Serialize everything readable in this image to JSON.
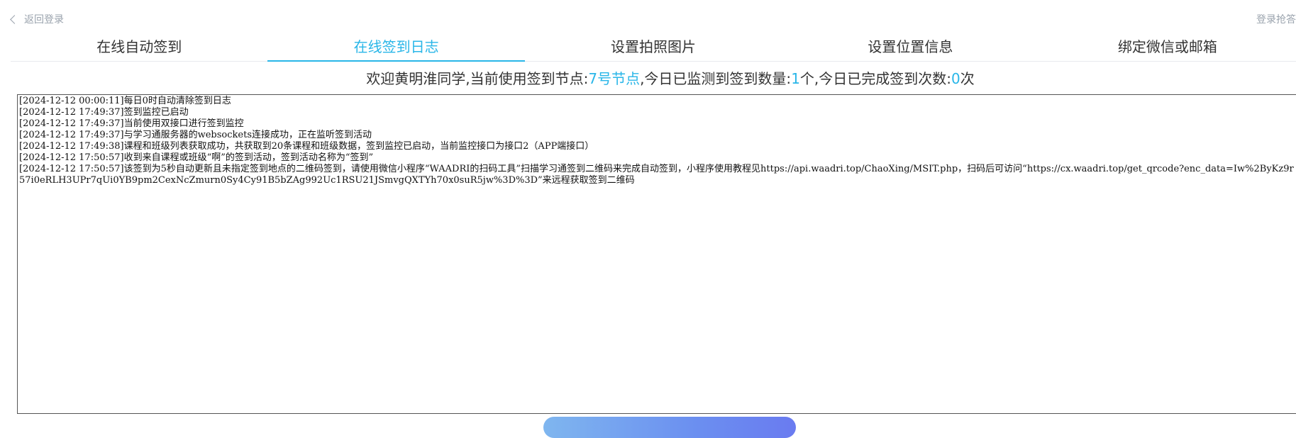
{
  "topbar": {
    "back_label": "返回登录",
    "login_label": "登录抢答"
  },
  "tabs": [
    {
      "label": "在线自动签到",
      "active": false
    },
    {
      "label": "在线签到日志",
      "active": true
    },
    {
      "label": "设置拍照图片",
      "active": false
    },
    {
      "label": "设置位置信息",
      "active": false
    },
    {
      "label": "绑定微信或邮箱",
      "active": false
    }
  ],
  "welcome": {
    "prefix": "欢迎黄明淮同学,当前使用签到节点:",
    "node": "7号节点",
    "mid1": ",今日已监测到签到数量:",
    "detected_count": "1",
    "mid2": "个,今日已完成签到次数:",
    "completed_count": "0",
    "suffix": "次"
  },
  "log": [
    "[2024-12-12 00:00:11]每日0时自动清除签到日志",
    "[2024-12-12 17:49:37]签到监控已启动",
    "[2024-12-12 17:49:37]当前使用双接口进行签到监控",
    "[2024-12-12 17:49:37]与学习通服务器的websockets连接成功，正在监听签到活动",
    "[2024-12-12 17:49:38]课程和班级列表获取成功，共获取到20条课程和班级数据，签到监控已启动，当前监控接口为接口2（APP端接口）",
    "[2024-12-12 17:50:57]收到来自课程或班级“啊”的签到活动，签到活动名称为“签到”",
    "[2024-12-12 17:50:57]该签到为5秒自动更新且未指定签到地点的二维码签到，请使用微信小程序“WAADRI的扫码工具”扫描学习通签到二维码来完成自动签到，小程序使用教程见https://api.waadri.top/ChaoXing/MSIT.php，扫码后可访问“https://cx.waadri.top/get_qrcode?enc_data=Iw%2ByKz9r57i0eRLH3UPr7qUi0YB9pm2CexNcZmurn0Sy4Cy91B5bZAg992Uc1RSU21JSmvgQXTYh70x0suR5jw%3D%3D”来远程获取签到二维码"
  ],
  "colors": {
    "accent": "#29b6e8",
    "muted": "#9aa3ad",
    "button_gradient_start": "#7fb6ef",
    "button_gradient_end": "#6a7bf0"
  },
  "icons": {
    "back": "chevron-left-icon"
  }
}
